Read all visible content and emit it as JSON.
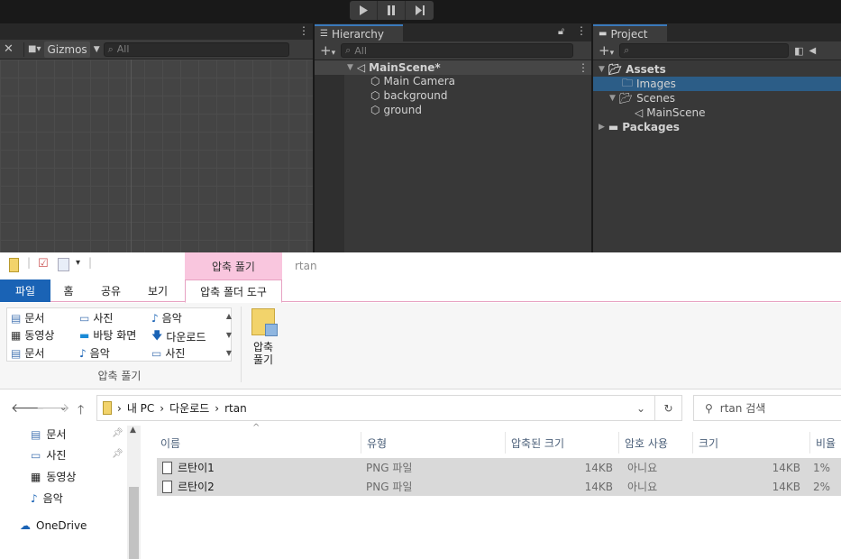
{
  "unity": {
    "toolbar": {
      "play_icon": "play-icon",
      "pause_icon": "pause-icon",
      "step_icon": "step-icon"
    },
    "scene": {
      "gizmos_label": "Gizmos",
      "search_placeholder": "All"
    },
    "hierarchy": {
      "tab_label": "Hierarchy",
      "search_placeholder": "All",
      "scene_name": "MainScene*",
      "items": [
        "Main Camera",
        "background",
        "ground"
      ]
    },
    "project": {
      "tab_label": "Project",
      "tree": {
        "assets": "Assets",
        "images": "Images",
        "scenes": "Scenes",
        "mainscene": "MainScene",
        "packages": "Packages"
      }
    }
  },
  "explorer": {
    "context_tab": "압축 풀기",
    "window_title": "rtan",
    "tabs": {
      "file": "파일",
      "home": "홈",
      "share": "공유",
      "view": "보기",
      "tools": "압축 폴더 도구"
    },
    "gallery": [
      [
        "문서",
        "사진",
        "음악"
      ],
      [
        "동영상",
        "바탕 화면",
        "다운로드"
      ],
      [
        "문서",
        "음악",
        "사진"
      ]
    ],
    "group_label": "압축 풀기",
    "extract_all_label_1": "압축",
    "extract_all_label_2": "풀기",
    "breadcrumb": [
      "내 PC",
      "다운로드",
      "rtan"
    ],
    "search_placeholder": "rtan 검색",
    "nav": [
      "문서",
      "사진",
      "동영상",
      "음악",
      "OneDrive"
    ],
    "columns": {
      "name": "이름",
      "type": "유형",
      "packed": "압축된 크기",
      "password": "암호 사용",
      "size": "크기",
      "ratio": "비율"
    },
    "files": [
      {
        "name": "르탄이1",
        "type": "PNG 파일",
        "packed": "14KB",
        "password": "아니요",
        "size": "14KB",
        "ratio": "1%"
      },
      {
        "name": "르탄이2",
        "type": "PNG 파일",
        "packed": "14KB",
        "password": "아니요",
        "size": "14KB",
        "ratio": "2%"
      }
    ]
  },
  "colors": {
    "unity_bg": "#383838",
    "unity_selection": "#2c5d87",
    "explorer_file_tab": "#1a63b5",
    "context_tab": "#f9c6de"
  }
}
